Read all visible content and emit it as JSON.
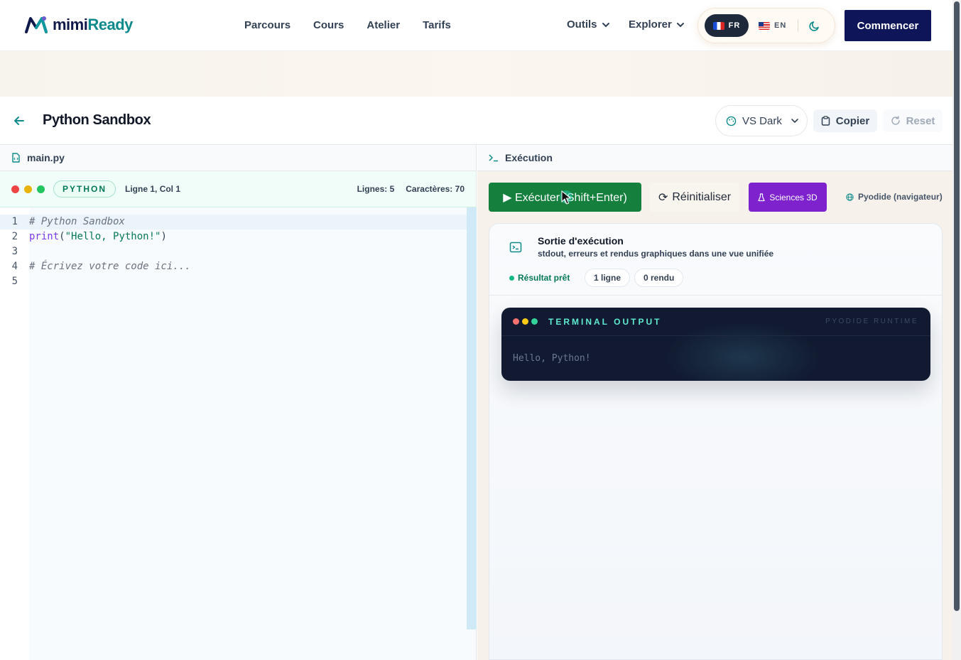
{
  "brand": {
    "name_part1": "mimi",
    "name_part2": "Ready"
  },
  "nav": {
    "links": [
      "Parcours",
      "Cours",
      "Atelier",
      "Tarifs"
    ],
    "tools_label": "Outils",
    "explore_label": "Explorer",
    "lang_active": "FR",
    "lang_other": "EN",
    "cta_label": "Commencer"
  },
  "sandbox": {
    "title": "Python Sandbox",
    "theme": "VS Dark",
    "copy_label": "Copier",
    "reset_label": "Reset"
  },
  "editor": {
    "filename": "main.py",
    "language": "PYTHON",
    "cursor": "Ligne 1, Col 1",
    "lines_stat": "Lignes: 5",
    "chars_stat": "Caractères: 70",
    "code_lines": [
      {
        "num": "1",
        "text": "# Python Sandbox",
        "kind": "comment"
      },
      {
        "num": "2",
        "text": "print(\"Hello, Python!\")",
        "kind": "call"
      },
      {
        "num": "3",
        "text": "",
        "kind": "blank"
      },
      {
        "num": "4",
        "text": "# Écrivez votre code ici...",
        "kind": "comment"
      },
      {
        "num": "5",
        "text": "",
        "kind": "blank"
      }
    ],
    "code_kw": "print",
    "code_paren_open": "(",
    "code_str": "\"Hello, Python!\"",
    "code_paren_close": ")"
  },
  "execution": {
    "tab_label": "Exécution",
    "run_label": "▶ Exécuter (Shift+Enter)",
    "reinit_label": "Réinitialiser",
    "science_label": "Sciences 3D",
    "runtime_label": "Pyodide (navigateur)",
    "output_title": "Sortie d'exécution",
    "output_subtitle": "stdout, erreurs et rendus graphiques dans une vue unifiée",
    "status": "Résultat prêt",
    "chip_lines": "1 ligne",
    "chip_renders": "0 rendu",
    "terminal_title": "TERMINAL OUTPUT",
    "terminal_runtime": "PYODIDE RUNTIME",
    "terminal_output": "Hello, Python!"
  },
  "colors": {
    "brand_navy": "#0f1559",
    "brand_teal": "#0e8a8a",
    "run_green": "#15803d",
    "science_purple": "#7e22ce",
    "dot_red": "#ef4444",
    "dot_yellow": "#eab308",
    "dot_green": "#22c55e"
  },
  "icons": [
    "logo-mark-icon",
    "chevron-down-icon",
    "moon-icon",
    "back-arrow-icon",
    "palette-icon",
    "clipboard-icon",
    "refresh-icon",
    "file-code-icon",
    "terminal-prompt-icon",
    "flask-icon",
    "globe-icon",
    "terminal-icon",
    "mouse-pointer-icon"
  ]
}
